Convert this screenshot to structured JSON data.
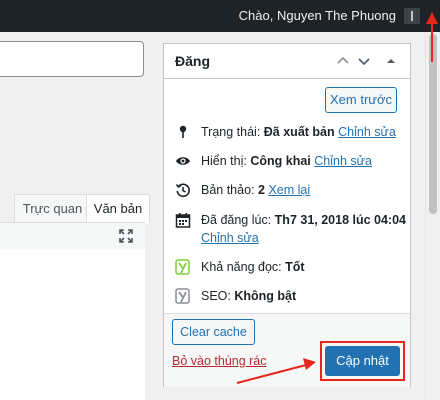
{
  "admin_bar": {
    "greeting": "Chào, Nguyen The Phuong"
  },
  "editor": {
    "tabs": [
      "Trực quan",
      "Văn bản"
    ]
  },
  "publish": {
    "title": "Đăng",
    "preview_label": "Xem trước",
    "status": {
      "label": "Trạng thái:",
      "value": "Đã xuất bản",
      "edit": "Chỉnh sửa"
    },
    "visibility": {
      "label": "Hiển thị:",
      "value": "Công khai",
      "edit": "Chỉnh sửa"
    },
    "revisions": {
      "label": "Bản thảo:",
      "value": "2",
      "link": "Xem lại"
    },
    "published_on": {
      "label": "Đã đăng lúc:",
      "value": "Th7 31, 2018 lúc 04:04",
      "edit": "Chỉnh sửa"
    },
    "readability": {
      "label": "Khả năng đọc:",
      "value": "Tốt"
    },
    "seo": {
      "label": "SEO:",
      "value": "Không bật"
    },
    "clear_cache_label": "Clear cache",
    "trash_label": "Bỏ vào thùng rác",
    "update_label": "Cập nhật"
  },
  "colors": {
    "accent": "#2271b1",
    "annotation": "#e8261b",
    "admin_bar": "#1d2327",
    "readability_good": "#7ad03a"
  }
}
